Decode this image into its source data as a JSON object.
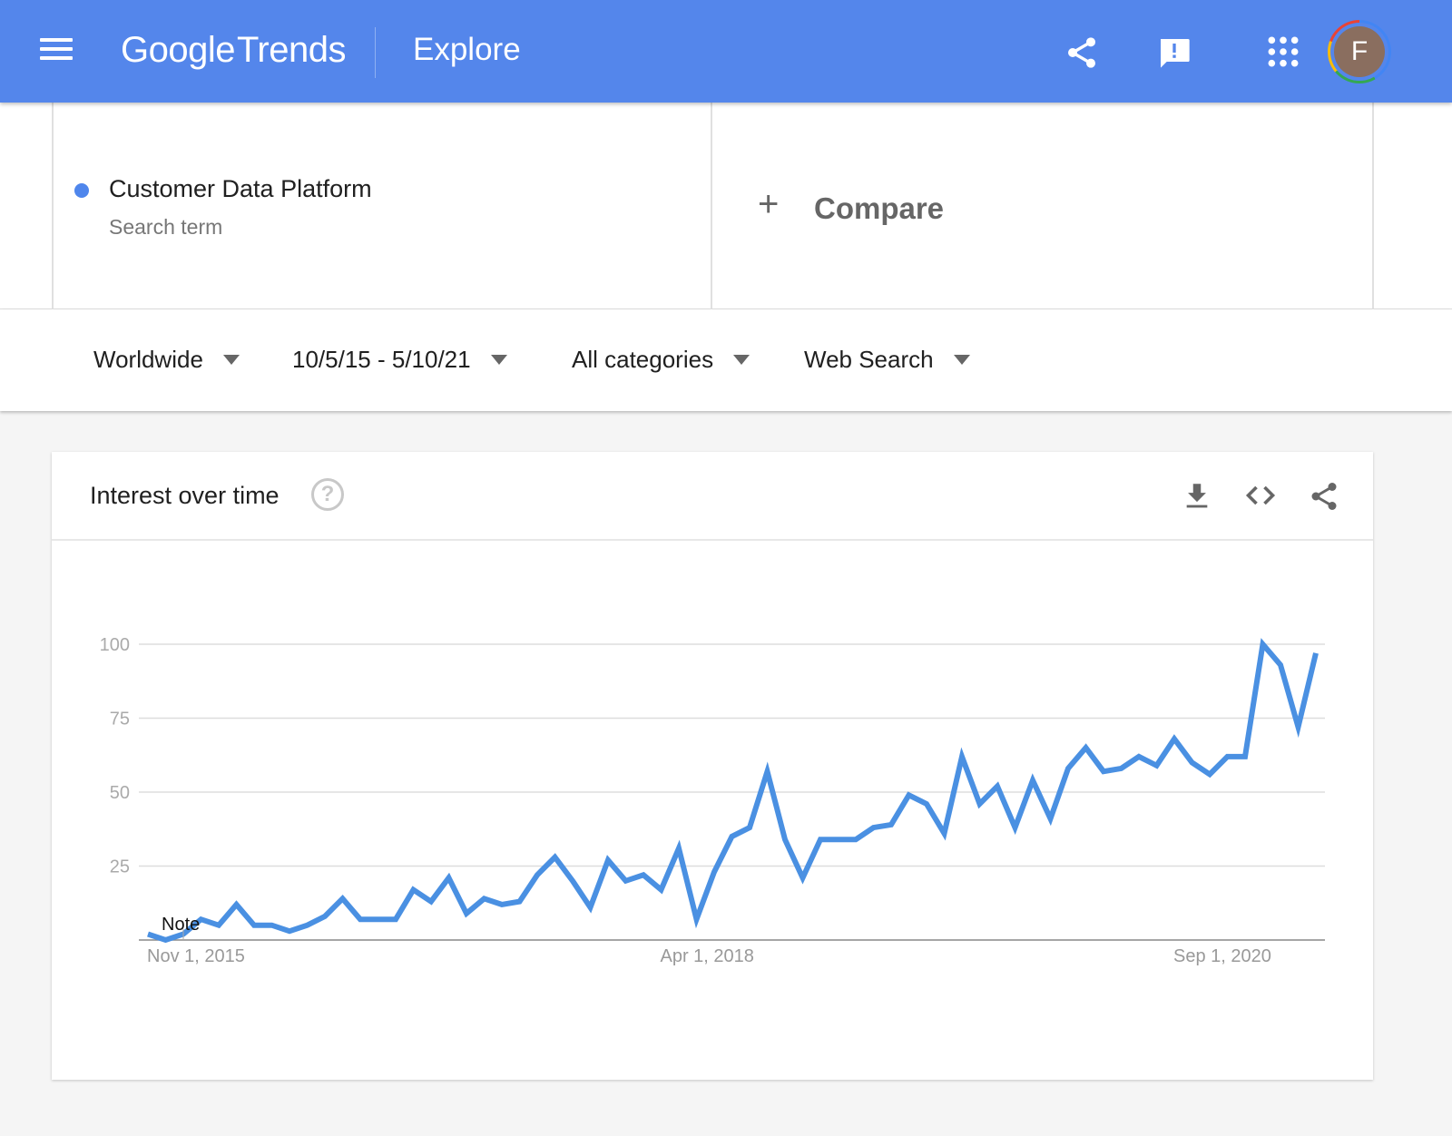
{
  "header": {
    "logo_google": "Google",
    "logo_trends": "Trends",
    "page_title": "Explore",
    "avatar_initial": "F",
    "icons": [
      "menu-icon",
      "share-icon",
      "feedback-icon",
      "apps-grid-icon"
    ]
  },
  "search": {
    "term": "Customer Data Platform",
    "term_type": "Search term",
    "term_color": "#4f86ec",
    "compare_label": "Compare"
  },
  "filters": {
    "region": "Worldwide",
    "date_range": "10/5/15 - 5/10/21",
    "category": "All categories",
    "search_type": "Web Search"
  },
  "card": {
    "title": "Interest over time",
    "help_symbol": "?",
    "icons": [
      "download-icon",
      "embed-code-icon",
      "share-icon"
    ]
  },
  "chart_data": {
    "type": "line",
    "title": "Interest over time",
    "xlabel": "",
    "ylabel": "",
    "ylim": [
      0,
      100
    ],
    "yticks": [
      25,
      50,
      75,
      100
    ],
    "xtick_labels": [
      "Nov 1, 2015",
      "Apr 1, 2018",
      "Sep 1, 2020"
    ],
    "xtick_positions": [
      2,
      31,
      60
    ],
    "grid": true,
    "legend": "none",
    "annotation": {
      "text": "Note",
      "index": 2
    },
    "series": [
      {
        "name": "Customer Data Platform",
        "color": "#4a90e2",
        "values": [
          2,
          0,
          2,
          7,
          5,
          12,
          5,
          5,
          3,
          5,
          8,
          14,
          7,
          7,
          7,
          17,
          13,
          21,
          9,
          14,
          12,
          13,
          22,
          28,
          20,
          11,
          27,
          20,
          22,
          17,
          31,
          7,
          23,
          35,
          38,
          57,
          34,
          21,
          34,
          34,
          34,
          38,
          39,
          49,
          46,
          36,
          62,
          46,
          52,
          38,
          54,
          41,
          58,
          65,
          57,
          58,
          62,
          59,
          68,
          60,
          56,
          62,
          62,
          100,
          93,
          72,
          97
        ]
      }
    ]
  }
}
